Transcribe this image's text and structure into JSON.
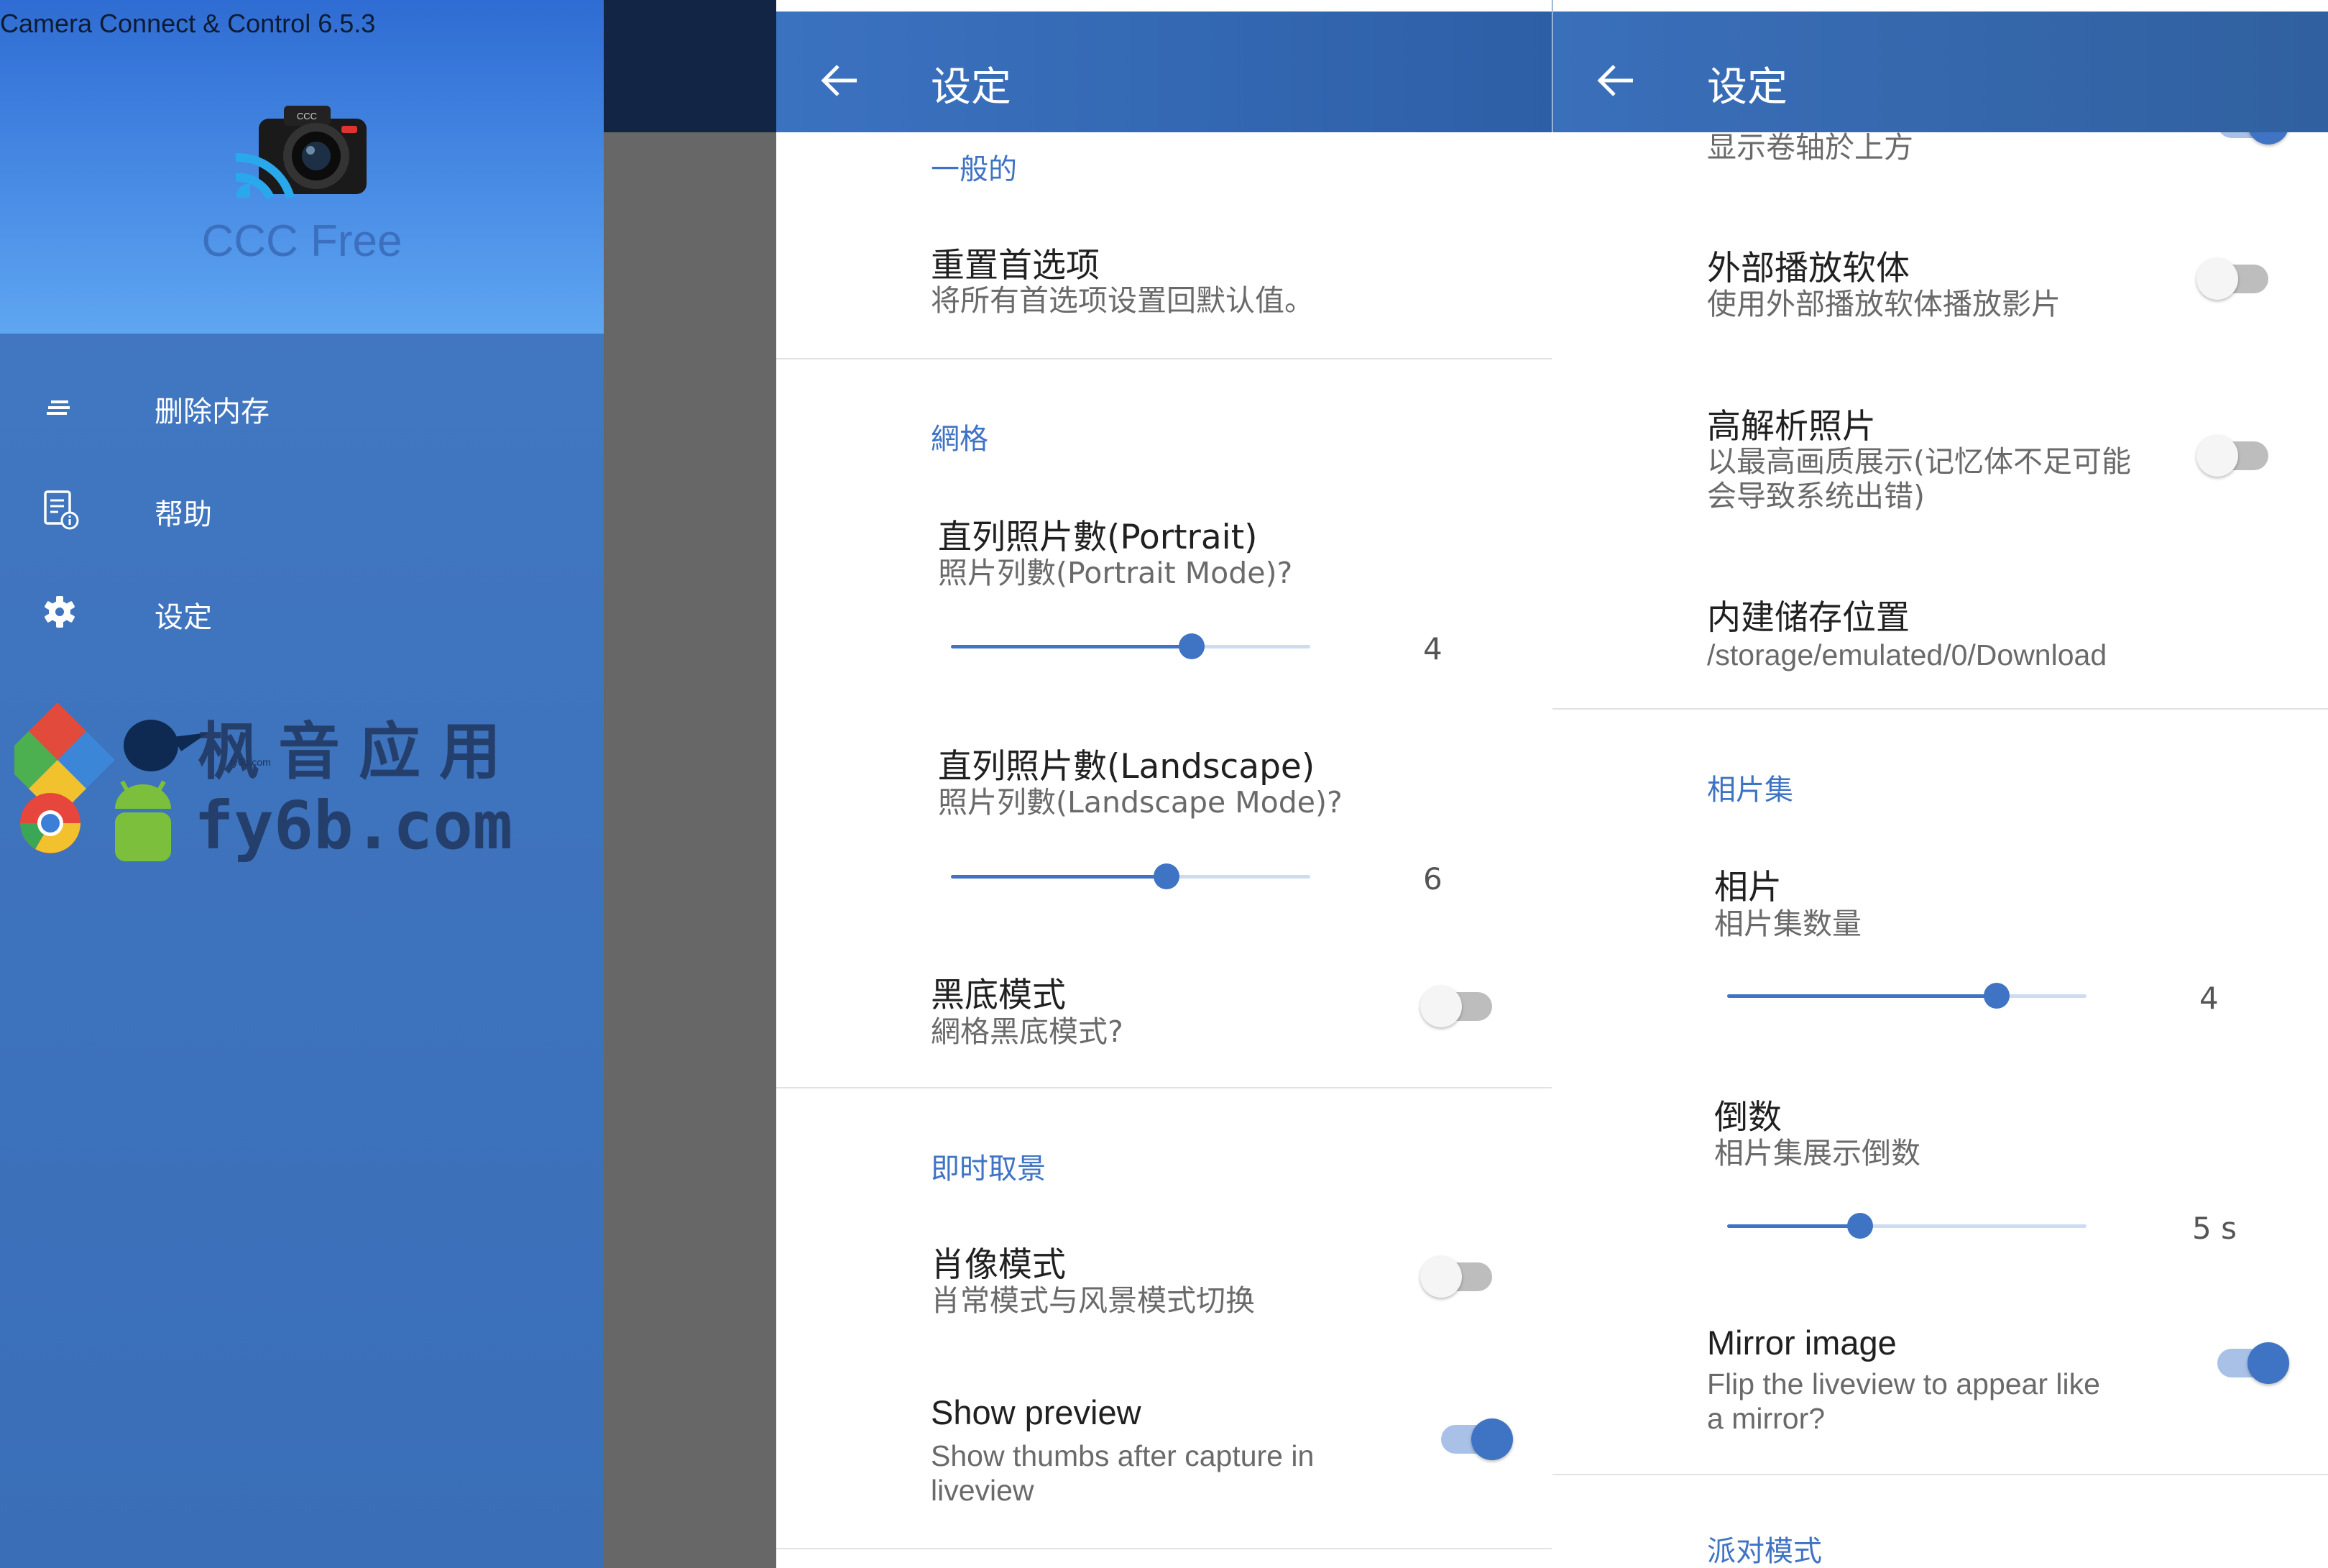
{
  "window_title": "Camera Connect & Control 6.5.3",
  "drawer": {
    "app_name": "CCC Free",
    "camera_badge": "CCC",
    "items": [
      {
        "label": "删除内存",
        "icon": "clear-list-icon"
      },
      {
        "label": "帮助",
        "icon": "help-manual-icon"
      },
      {
        "label": "设定",
        "icon": "gear-icon"
      }
    ],
    "watermark": {
      "line1": "枫音应用",
      "line2": "fy6b.com",
      "small": "fy6b.com"
    }
  },
  "panel1": {
    "title": "设定",
    "sections": {
      "general": "一般的",
      "grid": "網格",
      "liveview": "即时取景"
    },
    "reset": {
      "title": "重置首选项",
      "summary": "将所有首选项设置回默认值。"
    },
    "portrait": {
      "title": "直列照片數(Portrait)",
      "summary": "照片列數(Portrait Mode)?",
      "value": "4",
      "fraction": 0.67
    },
    "landscape": {
      "title": "直列照片數(Landscape)",
      "summary": "照片列數(Landscape Mode)?",
      "value": "6",
      "fraction": 0.6
    },
    "dark_grid": {
      "title": "黑底模式",
      "summary": "網格黑底模式?",
      "on": false
    },
    "portrait_mode": {
      "title": "肖像模式",
      "summary": "肖常模式与风景模式切换",
      "on": false
    },
    "show_preview": {
      "title": "Show preview",
      "summary_line1": "Show thumbs after capture in",
      "summary_line2": "liveview",
      "on": true
    }
  },
  "panel2": {
    "title": "设定",
    "scroll_item": {
      "summary": "显示卷轴於上方",
      "on": true
    },
    "external_player": {
      "title": "外部播放软体",
      "summary": "使用外部播放软体播放影片",
      "on": false
    },
    "hires": {
      "title": "高解析照片",
      "summary_line1": "以最高画质展示(记忆体不足可能",
      "summary_line2": "会导致系统出错)",
      "on": false
    },
    "storage": {
      "title": "内建储存位置",
      "summary": "/storage/emulated/0/Download"
    },
    "sections": {
      "album": "相片集",
      "party": "派对模式"
    },
    "photos": {
      "title": "相片",
      "summary": "相片集数量",
      "value": "4",
      "fraction": 0.75
    },
    "countdown": {
      "title": "倒数",
      "summary": "相片集展示倒数",
      "value": "5 s",
      "fraction": 0.37
    },
    "mirror": {
      "title": "Mirror image",
      "summary_line1": "Flip the liveview to appear like",
      "summary_line2": "a mirror?",
      "on": true
    }
  },
  "colors": {
    "accent": "#3f73c4",
    "drawer": "#3e73bd",
    "header": "#4a8ee6",
    "scrim": "#676767"
  }
}
